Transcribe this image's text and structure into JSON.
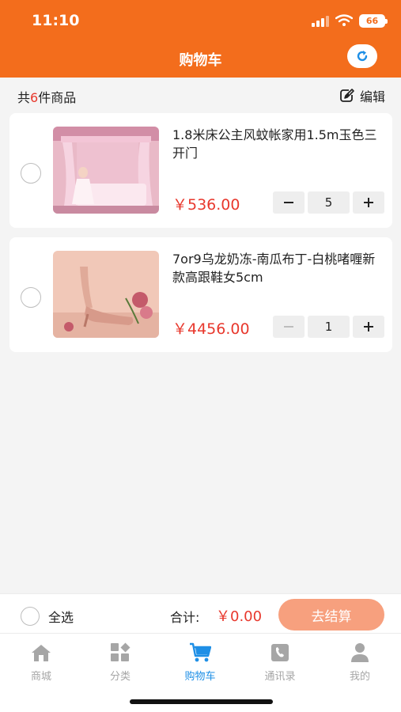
{
  "status_bar": {
    "time": "11:10",
    "battery": "66",
    "icons": [
      "signal-icon",
      "wifi-icon",
      "battery-icon"
    ]
  },
  "header": {
    "title": "购物车",
    "refresh_icon": "refresh-icon"
  },
  "summary": {
    "prefix": "共",
    "count": "6",
    "suffix": "件商品",
    "edit_label": "编辑",
    "edit_icon": "edit-icon"
  },
  "cart_items": [
    {
      "title": "1.8米床公主风蚊帐家用1.5m玉色三开门",
      "price": "￥536.00",
      "quantity": "5",
      "image": "canopy-bed-photo"
    },
    {
      "title": "7or9乌龙奶冻-南瓜布丁-白桃啫喱新款高跟鞋女5cm",
      "price": "￥4456.00",
      "quantity": "1",
      "image": "high-heel-shoe-photo"
    }
  ],
  "checkout": {
    "select_all": "全选",
    "total_label": "合计:",
    "total_value": "￥0.00",
    "button": "去结算"
  },
  "tabs": [
    {
      "label": "商城",
      "icon": "home-icon",
      "active": false
    },
    {
      "label": "分类",
      "icon": "category-icon",
      "active": false
    },
    {
      "label": "购物车",
      "icon": "cart-icon",
      "active": true
    },
    {
      "label": "通讯录",
      "icon": "contacts-icon",
      "active": false
    },
    {
      "label": "我的",
      "icon": "user-icon",
      "active": false
    }
  ],
  "colors": {
    "primary": "#f36d1c",
    "price": "#e8382d",
    "active_tab": "#1e8fe6",
    "checkout_button": "#f7a07e"
  }
}
